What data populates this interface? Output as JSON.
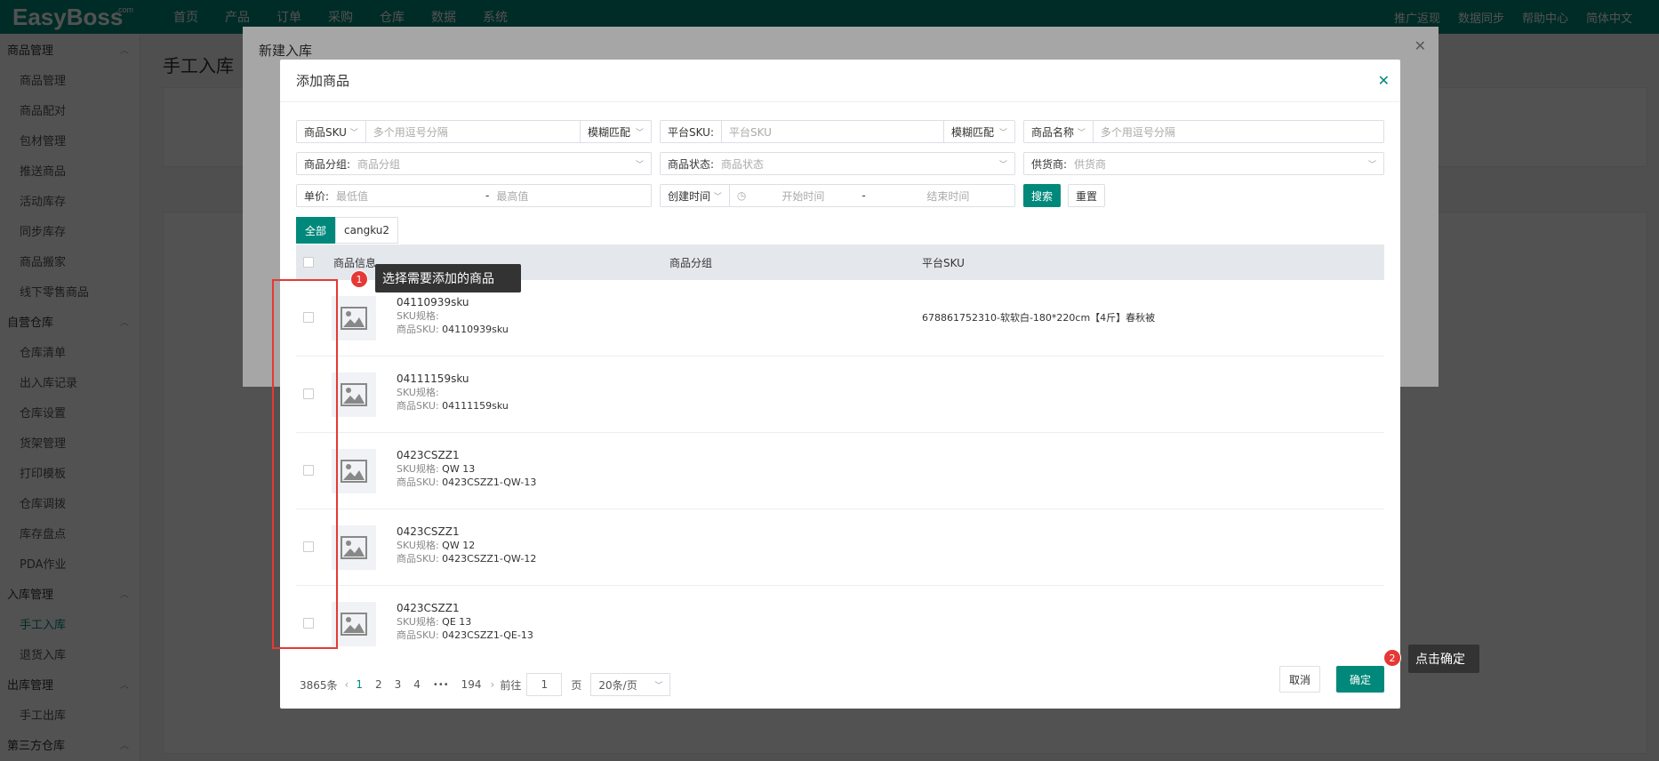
{
  "topbar": {
    "logo": "EasyBoss",
    "logo_sup": ".com",
    "nav": [
      "首页",
      "产品",
      "订单",
      "采购",
      "仓库",
      "数据",
      "系统"
    ],
    "right": [
      "推广返现",
      "数据同步",
      "帮助中心",
      "简体中文"
    ]
  },
  "sidebar": {
    "groups": [
      {
        "label": "商品管理",
        "items": [
          "商品管理",
          "商品配对",
          "包材管理",
          "推送商品",
          "活动库存",
          "同步库存",
          "商品搬家",
          "线下零售商品"
        ]
      },
      {
        "label": "自营仓库",
        "items": [
          "仓库清单",
          "出入库记录",
          "仓库设置",
          "货架管理",
          "打印模板",
          "仓库调拨",
          "库存盘点",
          "PDA作业"
        ]
      },
      {
        "label": "入库管理",
        "items": [
          "手工入库",
          "退货入库"
        ]
      },
      {
        "label": "出库管理",
        "items": [
          "手工出库"
        ]
      },
      {
        "label": "第三方仓库",
        "items": []
      }
    ],
    "active": "手工入库"
  },
  "page_title": "手工入库",
  "dialog_outer": {
    "title": "新建入库"
  },
  "dialog": {
    "title": "添加商品",
    "filters": {
      "sku_label": "商品SKU",
      "sku_placeholder": "多个用逗号分隔",
      "sku_match": "模糊匹配",
      "platform_sku_label": "平台SKU:",
      "platform_sku_placeholder": "平台SKU",
      "platform_match": "模糊匹配",
      "name_label": "商品名称",
      "name_placeholder": "多个用逗号分隔",
      "group_label": "商品分组:",
      "group_placeholder": "商品分组",
      "status_label": "商品状态:",
      "status_placeholder": "商品状态",
      "supplier_label": "供货商:",
      "supplier_placeholder": "供货商",
      "price_label": "单价:",
      "price_min": "最低值",
      "price_sep": "-",
      "price_max": "最高值",
      "time_label": "创建时间",
      "time_start": "开始时间",
      "time_sep": "-",
      "time_end": "结束时间",
      "search_btn": "搜索",
      "reset_btn": "重置"
    },
    "tabs": [
      "全部",
      "cangku2"
    ],
    "columns": [
      "商品信息",
      "商品分组",
      "平台SKU"
    ],
    "rows": [
      {
        "name": "04110939sku",
        "spec_label": "SKU规格:",
        "spec": "",
        "sku_label": "商品SKU:",
        "sku": "04110939sku",
        "platform_sku": "678861752310-软软白-180*220cm【4斤】春秋被"
      },
      {
        "name": "04111159sku",
        "spec_label": "SKU规格:",
        "spec": "",
        "sku_label": "商品SKU:",
        "sku": "04111159sku",
        "platform_sku": ""
      },
      {
        "name": "0423CSZZ1",
        "spec_label": "SKU规格:",
        "spec": "QW 13",
        "sku_label": "商品SKU:",
        "sku": "0423CSZZ1-QW-13",
        "platform_sku": ""
      },
      {
        "name": "0423CSZZ1",
        "spec_label": "SKU规格:",
        "spec": "QW 12",
        "sku_label": "商品SKU:",
        "sku": "0423CSZZ1-QW-12",
        "platform_sku": ""
      },
      {
        "name": "0423CSZZ1",
        "spec_label": "SKU规格:",
        "spec": "QE 13",
        "sku_label": "商品SKU:",
        "sku": "0423CSZZ1-QE-13",
        "platform_sku": ""
      }
    ],
    "pagination": {
      "total": "3865条",
      "pages": [
        "1",
        "2",
        "3",
        "4"
      ],
      "ellipsis": "•••",
      "last": "194",
      "goto_label": "前往",
      "goto_value": "1",
      "page_unit": "页",
      "page_size": "20条/页"
    },
    "cancel_btn": "取消",
    "confirm_btn": "确定"
  },
  "annotations": {
    "step1_num": "1",
    "step1_text": "选择需要添加的商品",
    "step2_num": "2",
    "step2_text": "点击确定"
  },
  "colors": {
    "primary": "#00897b",
    "annotation_red": "#e53935"
  }
}
